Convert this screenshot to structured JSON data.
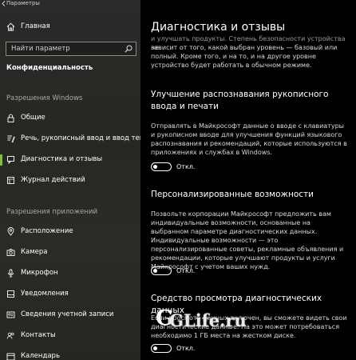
{
  "window": {
    "title": "Параметры"
  },
  "sidebar": {
    "home_label": "Главная",
    "search_placeholder": "Найти параметр",
    "privacy_header": "Конфиденциальность",
    "windows_section": "Разрешения Windows",
    "windows_items": [
      {
        "label": "Общие",
        "icon": "lock-icon"
      },
      {
        "label": "Речь, рукописный ввод и ввод текста",
        "icon": "speech-icon"
      },
      {
        "label": "Диагностика и отзывы",
        "icon": "feedback-icon",
        "active": true
      },
      {
        "label": "Журнал действий",
        "icon": "history-icon"
      }
    ],
    "apps_section": "Разрешения приложений",
    "apps_items": [
      {
        "label": "Расположение",
        "icon": "location-icon"
      },
      {
        "label": "Камера",
        "icon": "camera-icon"
      },
      {
        "label": "Микрофон",
        "icon": "microphone-icon"
      },
      {
        "label": "Уведомления",
        "icon": "notifications-icon"
      },
      {
        "label": "Сведения учетной записи",
        "icon": "account-icon"
      },
      {
        "label": "Контакты",
        "icon": "contacts-icon"
      },
      {
        "label": "Календарь",
        "icon": "calendar-icon"
      }
    ],
    "active_color": "#7fbf3f"
  },
  "main": {
    "title": "Диагностика и отзывы",
    "intro_lines": [
      "и улучшать продукты. Степень безопасности устройства не",
      "зависит от того, какой выбран уровень — базовый или",
      "полный. Кроме того, и на то, и на другое уровне",
      "устройство будет работать в обычном режиме."
    ],
    "sections": [
      {
        "title": "Улучшение распознавания рукописного ввода и печати",
        "description": "Отправлять в Майкрософт данные о вводе с клавиатуры и рукописном вводе для улучшения функций языкового распознавания и рекомендаций, которые используются в приложениях и службах в Windows.",
        "toggle_state": "Откл."
      },
      {
        "title": "Персонализированные возможности",
        "description": "Позвольте корпорации Майкрософт предложить вам индивидуальные возможности, основанные на выбранном параметре диагностических данных. Индивидуальные возможности — это персонализированные советы, рекламные объявления и рекомендации, которые улучшают продукты и услуги Майкрософт с учетом ваших нужд.",
        "toggle_state": "Откл."
      },
      {
        "title": "Средство просмотра диагностических данных",
        "description": "Если просмотр данных включен, вы сможете видеть свои диагностические данные. На это может потребоваться необходимо 1 ГБ места на жестком диске.",
        "toggle_state": "Откл."
      }
    ]
  },
  "watermark": {
    "text": "GLife.ru",
    "prefix": "G"
  }
}
